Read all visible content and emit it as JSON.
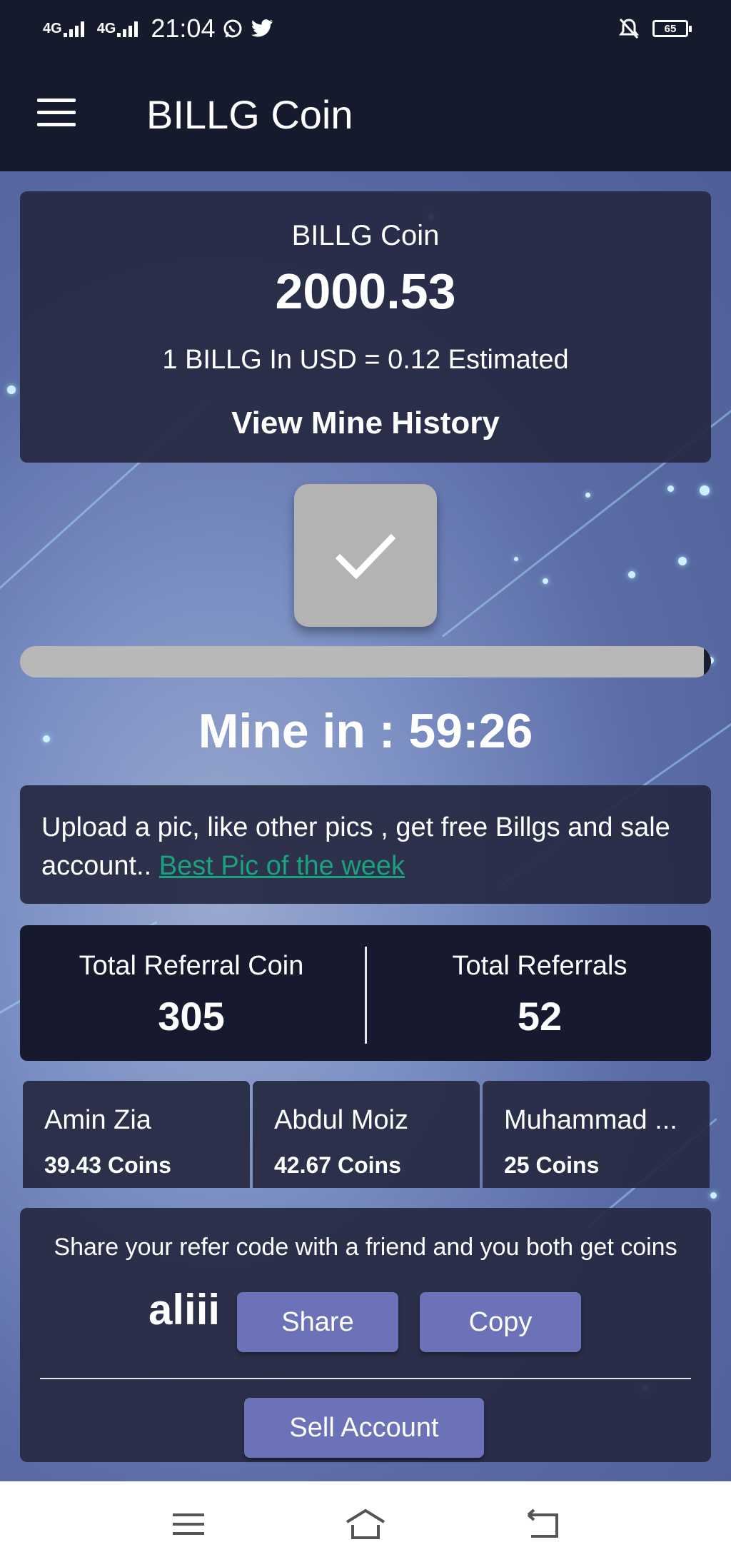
{
  "status_bar": {
    "network_1": "4G",
    "network_2": "4G",
    "time": "21:04",
    "battery": "65",
    "icons": [
      "signal-icon",
      "whatsapp-icon",
      "twitter-icon",
      "mute-bell-icon",
      "battery-icon"
    ]
  },
  "app_bar": {
    "title": "BILLG Coin",
    "menu_icon": "hamburger-icon"
  },
  "coin_card": {
    "label": "BILLG Coin",
    "balance": "2000.53",
    "rate": "1 BILLG In USD = 0.12 Estimated",
    "history_link": "View Mine History"
  },
  "mining": {
    "button_icon": "checkmark-icon",
    "progress": 0.99,
    "countdown": "Mine in : 59:26"
  },
  "news": {
    "text": "Upload a pic, like other pics , get free Billgs and sale account.. ",
    "link": "Best Pic of the week "
  },
  "referrals": {
    "coin_label": "Total Referral Coin",
    "coin_value": "305",
    "count_label": "Total Referrals",
    "count_value": "52"
  },
  "users": [
    {
      "name": "Amin Zia",
      "coins": "39.43 Coins"
    },
    {
      "name": "Abdul Moiz",
      "coins": "42.67 Coins"
    },
    {
      "name": "Muhammad ...",
      "coins": "25 Coins"
    }
  ],
  "share": {
    "text": "Share your refer code with a friend and you both get coins",
    "code": "aliii",
    "share_label": "Share",
    "copy_label": "Copy",
    "sell_label": "Sell Account"
  },
  "nav": {
    "icons": [
      "menu-icon",
      "home-icon",
      "back-icon"
    ]
  },
  "colors": {
    "header_bg": "#161a2d",
    "card_bg": "#262942",
    "button_bg": "#6c72b8",
    "link": "#1aa27d",
    "mine_button": "#b3b3b3"
  }
}
